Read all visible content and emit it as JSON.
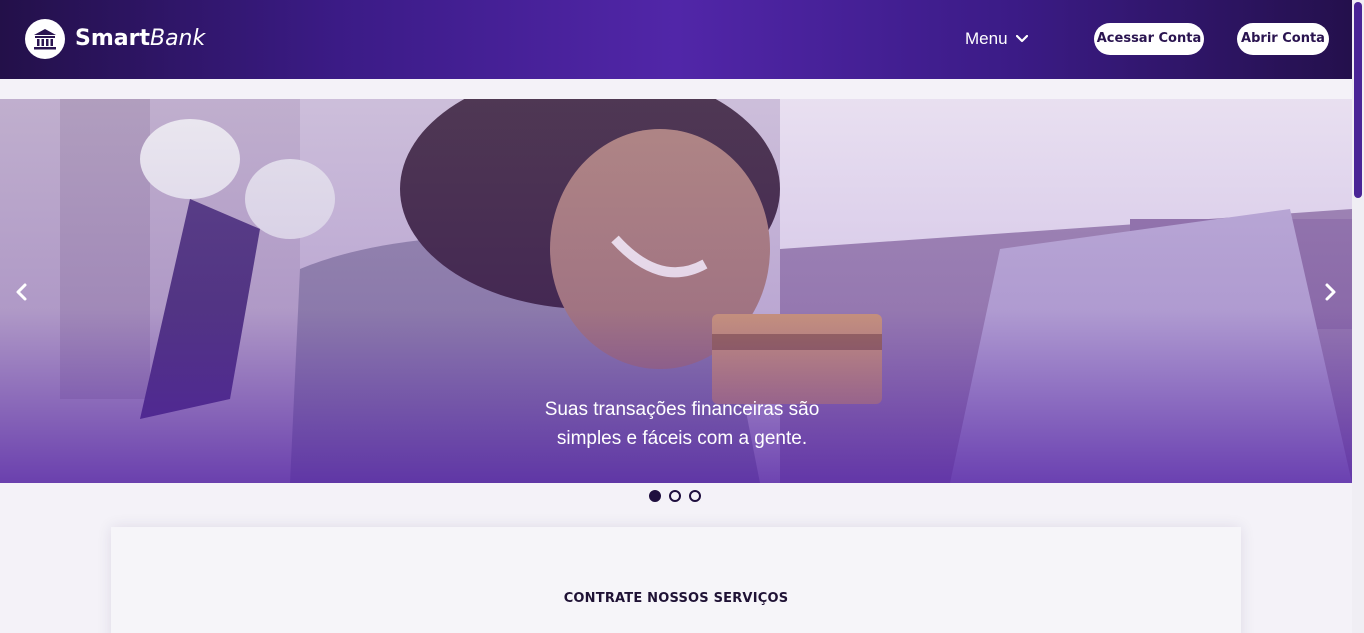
{
  "brand": {
    "name_bold": "Smart",
    "name_italic": "Bank",
    "logo_icon": "bank-icon"
  },
  "nav": {
    "menu_label": "Menu",
    "menu_icon": "chevron-down-icon",
    "login_label": "Acessar Conta",
    "open_account_label": "Abrir Conta"
  },
  "hero": {
    "caption_line1": "Suas transações financeiras são",
    "caption_line2": "simples e fáceis com a gente.",
    "prev_icon": "chevron-left-icon",
    "next_icon": "chevron-right-icon",
    "slides_count": 3,
    "active_slide": 1
  },
  "services": {
    "title": "CONTRATE NOSSOS SERVIÇOS"
  },
  "colors": {
    "header_dark": "#231049",
    "header_mid": "#5126a8",
    "accent": "#4a2496",
    "text_dark": "#1f1235",
    "page_bg": "#f4f2f8"
  }
}
